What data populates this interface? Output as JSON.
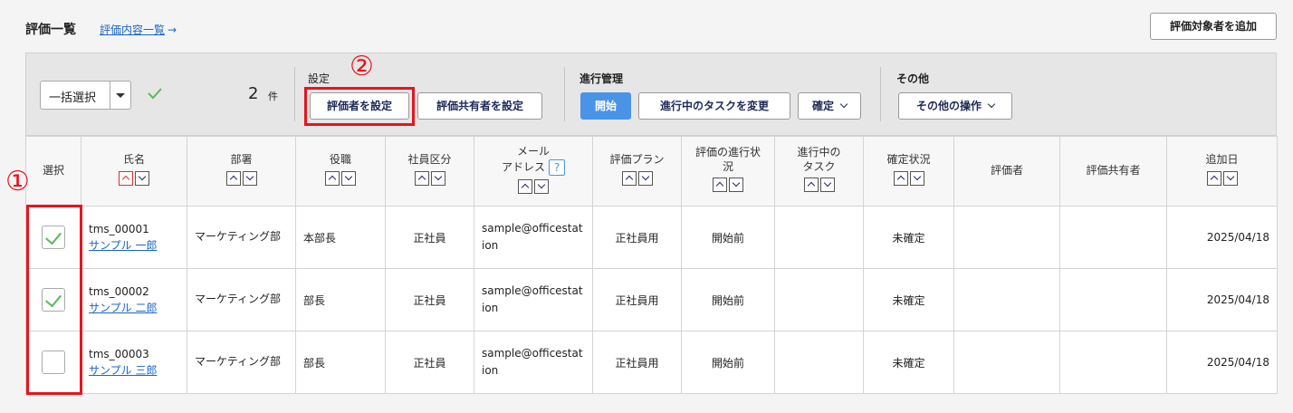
{
  "header": {
    "title": "評価一覧",
    "link_label": "評価内容一覧",
    "link_arrow": "→",
    "add_button_label": "評価対象者を追加"
  },
  "toolbar": {
    "bulk_select_label": "一括選択",
    "selected_count": "2",
    "count_unit": "件",
    "settings_group_label": "設定",
    "set_evaluator_label": "評価者を設定",
    "set_sharer_label": "評価共有者を設定",
    "progress_group_label": "進行管理",
    "start_label": "開始",
    "change_task_label": "進行中のタスクを変更",
    "confirm_label": "確定",
    "other_group_label": "その他",
    "other_ops_label": "その他の操作"
  },
  "annotations": {
    "marker_1": "①",
    "marker_2": "②"
  },
  "table": {
    "headers": {
      "select": "選択",
      "name": "氏名",
      "dept": "部署",
      "position": "役職",
      "emp_type": "社員区分",
      "mail_1": "メール",
      "mail_2": "アドレス",
      "mail_help": "?",
      "plan": "評価プラン",
      "status_1": "評価の進行状",
      "status_2": "況",
      "task_1": "進行中の",
      "task_2": "タスク",
      "confirm": "確定状況",
      "evaluator": "評価者",
      "sharer": "評価共有者",
      "added": "追加日"
    },
    "rows": [
      {
        "checked": true,
        "id": "tms_00001",
        "name": "サンプル 一郎",
        "dept": "マーケティング部",
        "position": "本部長",
        "emp_type": "正社員",
        "email": "sample@officestation",
        "plan": "正社員用",
        "status": "開始前",
        "task": "",
        "confirm": "未確定",
        "evaluator": "",
        "sharer": "",
        "added": "2025/04/18"
      },
      {
        "checked": true,
        "id": "tms_00002",
        "name": "サンプル 二郎",
        "dept": "マーケティング部",
        "position": "部長",
        "emp_type": "正社員",
        "email": "sample@officestation",
        "plan": "正社員用",
        "status": "開始前",
        "task": "",
        "confirm": "未確定",
        "evaluator": "",
        "sharer": "",
        "added": "2025/04/18"
      },
      {
        "checked": false,
        "id": "tms_00003",
        "name": "サンプル 三郎",
        "dept": "マーケティング部",
        "position": "部長",
        "emp_type": "正社員",
        "email": "sample@officestation",
        "plan": "正社員用",
        "status": "開始前",
        "task": "",
        "confirm": "未確定",
        "evaluator": "",
        "sharer": "",
        "added": "2025/04/18"
      }
    ]
  },
  "colors": {
    "accent": "#4a94e8",
    "link": "#1a66c8",
    "highlight": "#e8141e",
    "check": "#5cb85c"
  }
}
